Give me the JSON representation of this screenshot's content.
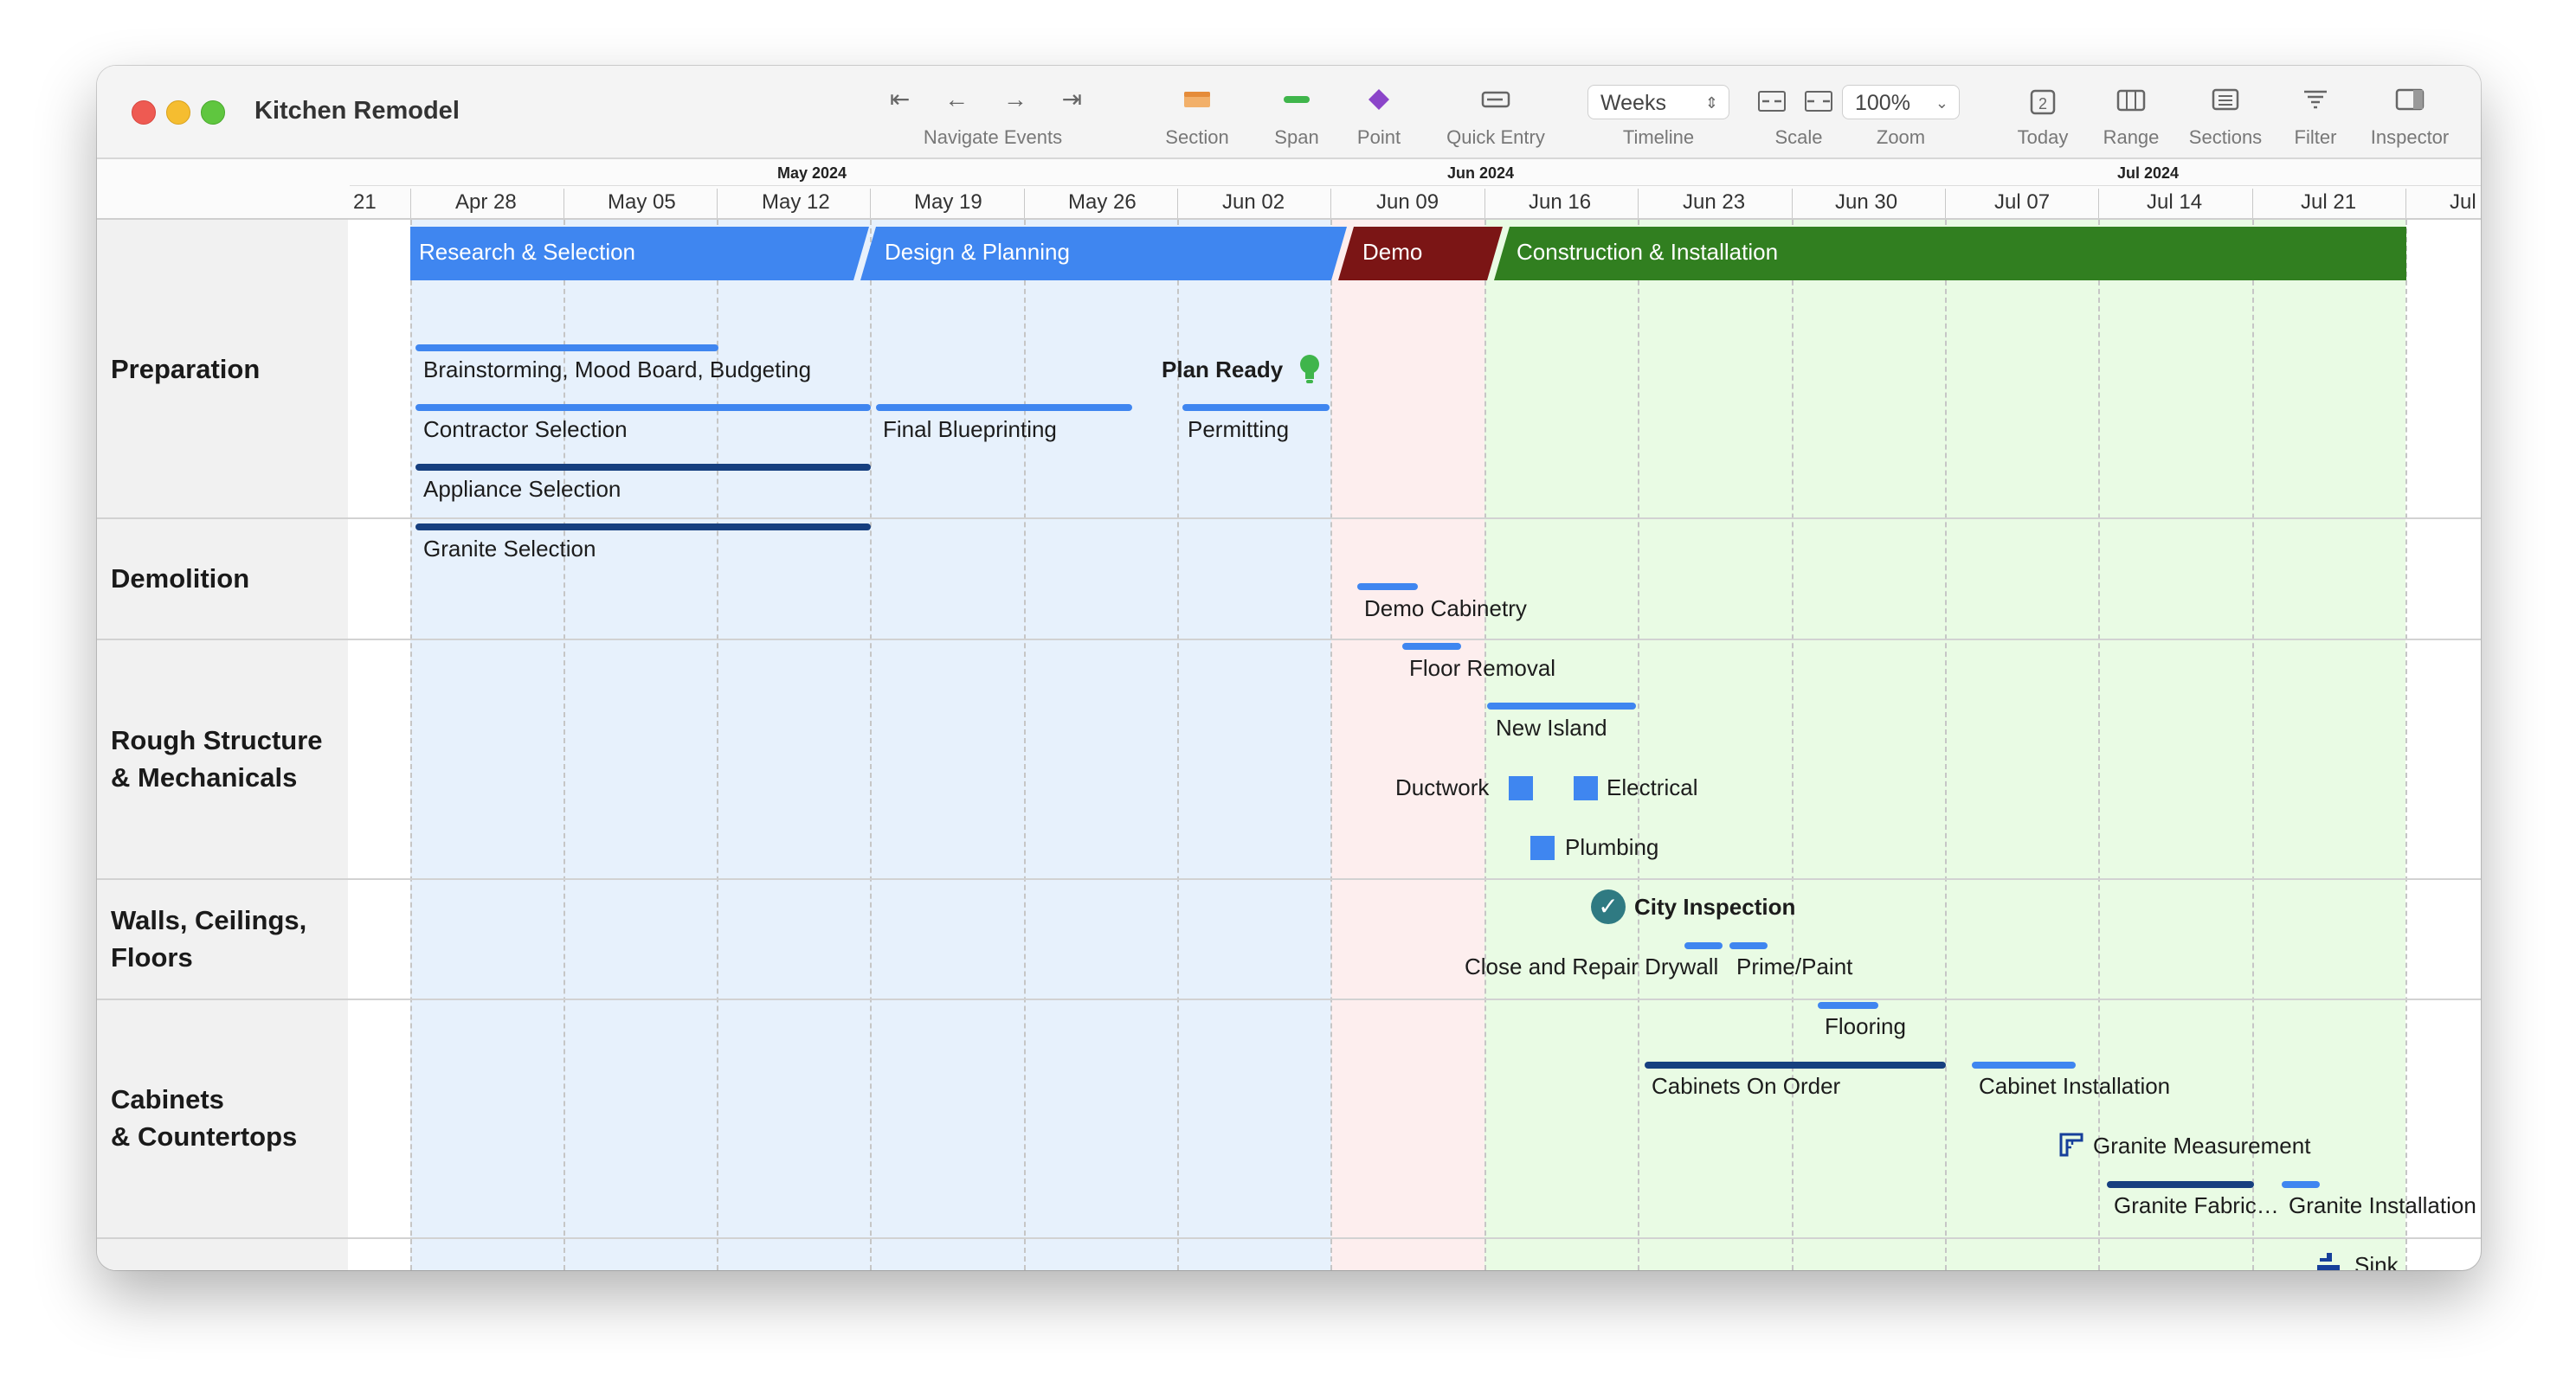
{
  "window": {
    "title": "Kitchen Remodel"
  },
  "toolbar": {
    "navigate_label": "Navigate Events",
    "nav_glyphs": "⇤ ← → ⇥",
    "section_label": "Section",
    "span_label": "Span",
    "point_label": "Point",
    "quick_entry_label": "Quick Entry",
    "timeline_value": "Weeks",
    "timeline_label": "Timeline",
    "scale_label": "Scale",
    "zoom_value": "100%",
    "zoom_label": "Zoom",
    "today_label": "Today",
    "today_day": "2",
    "range_label": "Range",
    "sections_label": "Sections",
    "filter_label": "Filter",
    "inspector_label": "Inspector"
  },
  "timeline_header": {
    "months": [
      "May 2024",
      "Jun 2024",
      "Jul 2024"
    ],
    "weeks": [
      "21",
      "Apr 28",
      "May 05",
      "May 12",
      "May 19",
      "May 26",
      "Jun 02",
      "Jun 09",
      "Jun 16",
      "Jun 23",
      "Jun 30",
      "Jul 07",
      "Jul 14",
      "Jul 21",
      "Jul"
    ]
  },
  "colors": {
    "research": "#3f86f0",
    "design": "#3f86f0",
    "demo": "#7b1515",
    "construction": "#317f20",
    "span_light": "#3f86f0",
    "span_dark": "#163f7f",
    "band_blue": "#e7f1fc",
    "band_pink": "#fdeeee",
    "band_green": "#e9fbe4",
    "milestone_bulb": "#3fb54b",
    "check": "#2f7a82",
    "icon_blue": "#163f9a"
  },
  "sections": {
    "preparation": "Preparation",
    "demolition": "Demolition",
    "rough": "Rough Structure\n& Mechanicals",
    "walls": "Walls, Ceilings,\nFloors",
    "cabinets": "Cabinets\n& Countertops"
  },
  "headers": {
    "research": "Research & Selection",
    "design": "Design & Planning",
    "demo": "Demo",
    "construction": "Construction & Installation"
  },
  "events": {
    "brainstorming": "Brainstorming, Mood Board, Budgeting",
    "plan_ready": "Plan Ready",
    "contractor": "Contractor Selection",
    "blueprinting": "Final Blueprinting",
    "permitting": "Permitting",
    "appliance": "Appliance Selection",
    "granite_sel": "Granite Selection",
    "demo_cab": "Demo Cabinetry",
    "floor_removal": "Floor Removal",
    "new_island": "New Island",
    "ductwork": "Ductwork",
    "electrical": "Electrical",
    "plumbing": "Plumbing",
    "city_inspection": "City Inspection",
    "drywall": "Close and Repair Drywall",
    "prime": "Prime/Paint",
    "flooring": "Flooring",
    "cab_order": "Cabinets On Order",
    "cab_install": "Cabinet Installation",
    "granite_meas": "Granite Measurement",
    "granite_fab": "Granite Fabric…",
    "granite_inst": "Granite Installation",
    "sink": "Sink"
  }
}
